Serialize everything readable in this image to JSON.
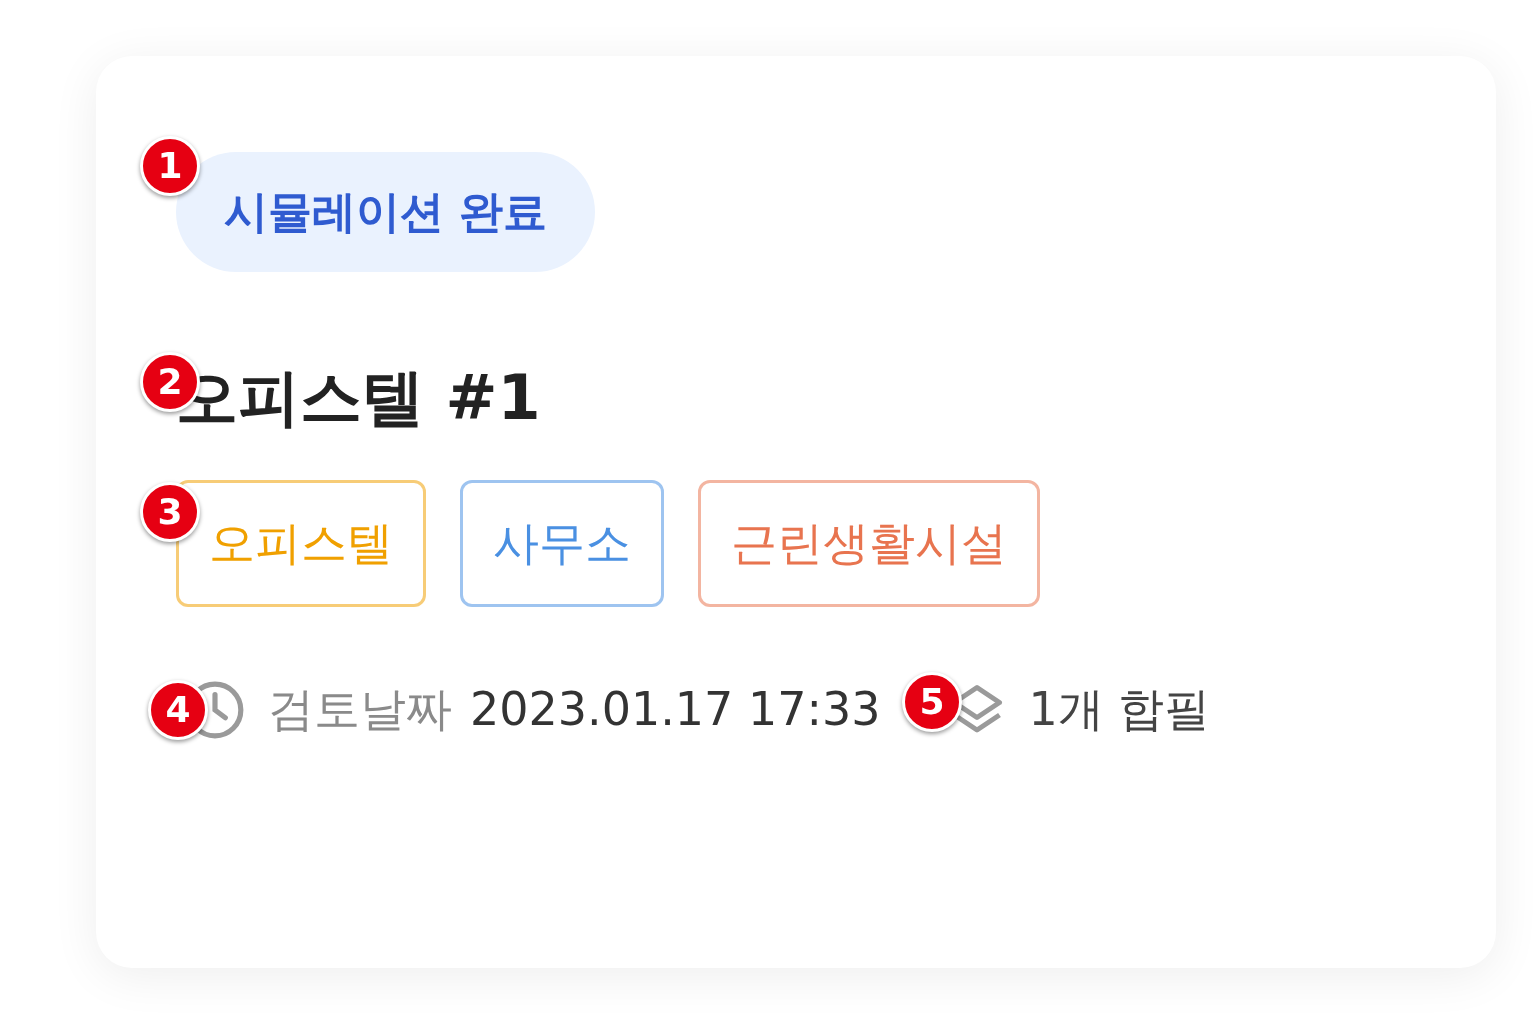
{
  "card": {
    "status": "시뮬레이션 완료",
    "title": "오피스텔 #1",
    "tags": [
      {
        "label": "오피스텔",
        "color": "#f0a000"
      },
      {
        "label": "사무소",
        "color": "#4a90e2"
      },
      {
        "label": "근린생활시설",
        "color": "#e8744f"
      }
    ],
    "review_label": "검토날짜",
    "review_value": "2023.01.17 17:33",
    "parcels": "1개 합필"
  },
  "markers": [
    "1",
    "2",
    "3",
    "4",
    "5"
  ]
}
